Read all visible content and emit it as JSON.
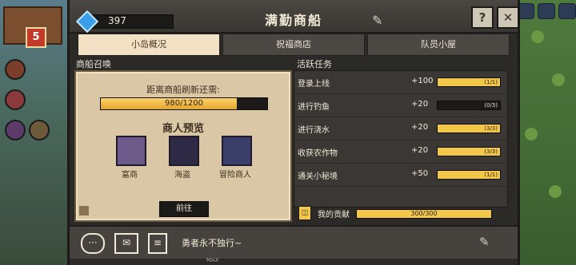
{
  "header": {
    "gem_count": "397",
    "title": "满勤商船"
  },
  "tabs": [
    {
      "label": "小岛概况",
      "active": true
    },
    {
      "label": "祝福商店",
      "active": false
    },
    {
      "label": "队员小屋",
      "active": false
    }
  ],
  "summon": {
    "section_title": "商船召唤",
    "refresh_label": "距离商船刷新还需:",
    "progress_text": "980/1200",
    "progress_fraction": 0.8167,
    "preview_title": "商人预览",
    "merchants": [
      {
        "name": "富商"
      },
      {
        "name": "海盗"
      },
      {
        "name": "冒险商人"
      }
    ],
    "goto_button": "前往"
  },
  "tasks": {
    "section_title": "活跃任务",
    "items": [
      {
        "name": "登录上线",
        "reward": "+100",
        "progress": "(1/1)",
        "fraction": 1.0
      },
      {
        "name": "进行钓鱼",
        "reward": "+20",
        "progress": "(0/3)",
        "fraction": 0.0
      },
      {
        "name": "进行浇水",
        "reward": "+20",
        "progress": "(3/3)",
        "fraction": 1.0
      },
      {
        "name": "收获农作物",
        "reward": "+20",
        "progress": "(3/3)",
        "fraction": 1.0
      },
      {
        "name": "通关小秘境",
        "reward": "+50",
        "progress": "(1/1)",
        "fraction": 1.0
      }
    ]
  },
  "contribution": {
    "label": "我的贡献",
    "text": "300/300",
    "fraction": 1.0
  },
  "bottom": {
    "message": "勇者永不独行~",
    "max_label": "MAX"
  },
  "background": {
    "badge_number": "5"
  }
}
